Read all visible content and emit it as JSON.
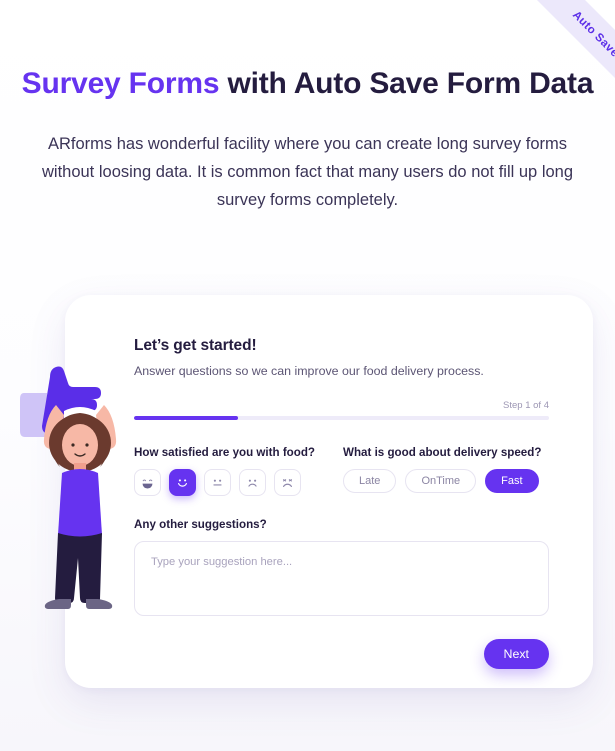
{
  "ribbon": {
    "text": "Auto Save Data",
    "color": "#5b2ee8",
    "band_color": "#ece8fb"
  },
  "hero": {
    "title_accent": "Survey Forms",
    "title_rest": " with Auto Save Form Data",
    "accent_color": "#6633f0",
    "paragraph": "ARforms has wonderful facility where you can create long survey forms without loosing data. It is common fact that many users do not fill up long survey forms completely."
  },
  "card": {
    "title": "Let’s get started!",
    "subtitle": "Answer questions so we can improve our food delivery process.",
    "progress": {
      "step_label": "Step 1 of 4",
      "current_step": 1,
      "total_steps": 4,
      "percent": 25,
      "fill_color": "#6633f0",
      "track_color": "#eeebf9"
    },
    "question_satisfaction": {
      "label": "How satisfied are you with food?",
      "options": [
        {
          "name": "very-happy",
          "selected": false
        },
        {
          "name": "happy",
          "selected": true
        },
        {
          "name": "neutral",
          "selected": false
        },
        {
          "name": "unhappy",
          "selected": false
        },
        {
          "name": "very-unhappy",
          "selected": false
        }
      ]
    },
    "question_delivery": {
      "label": "What is good about delivery speed?",
      "options": [
        {
          "label": "Late",
          "selected": false
        },
        {
          "label": "OnTime",
          "selected": false
        },
        {
          "label": "Fast",
          "selected": true
        }
      ]
    },
    "question_suggestions": {
      "label": "Any other suggestions?",
      "placeholder": "Type your suggestion here...",
      "value": ""
    },
    "next_label": "Next"
  },
  "illustration": {
    "name": "person-holding-thumbs-up",
    "thumb_color": "#5a2ee8",
    "cuff_color": "#cfc4f7",
    "skin_color": "#f7b8a6",
    "hair_color": "#6b3a2e",
    "shirt_color": "#6633f0",
    "pants_color": "#241c3f",
    "shoe_color": "#6b6585"
  }
}
